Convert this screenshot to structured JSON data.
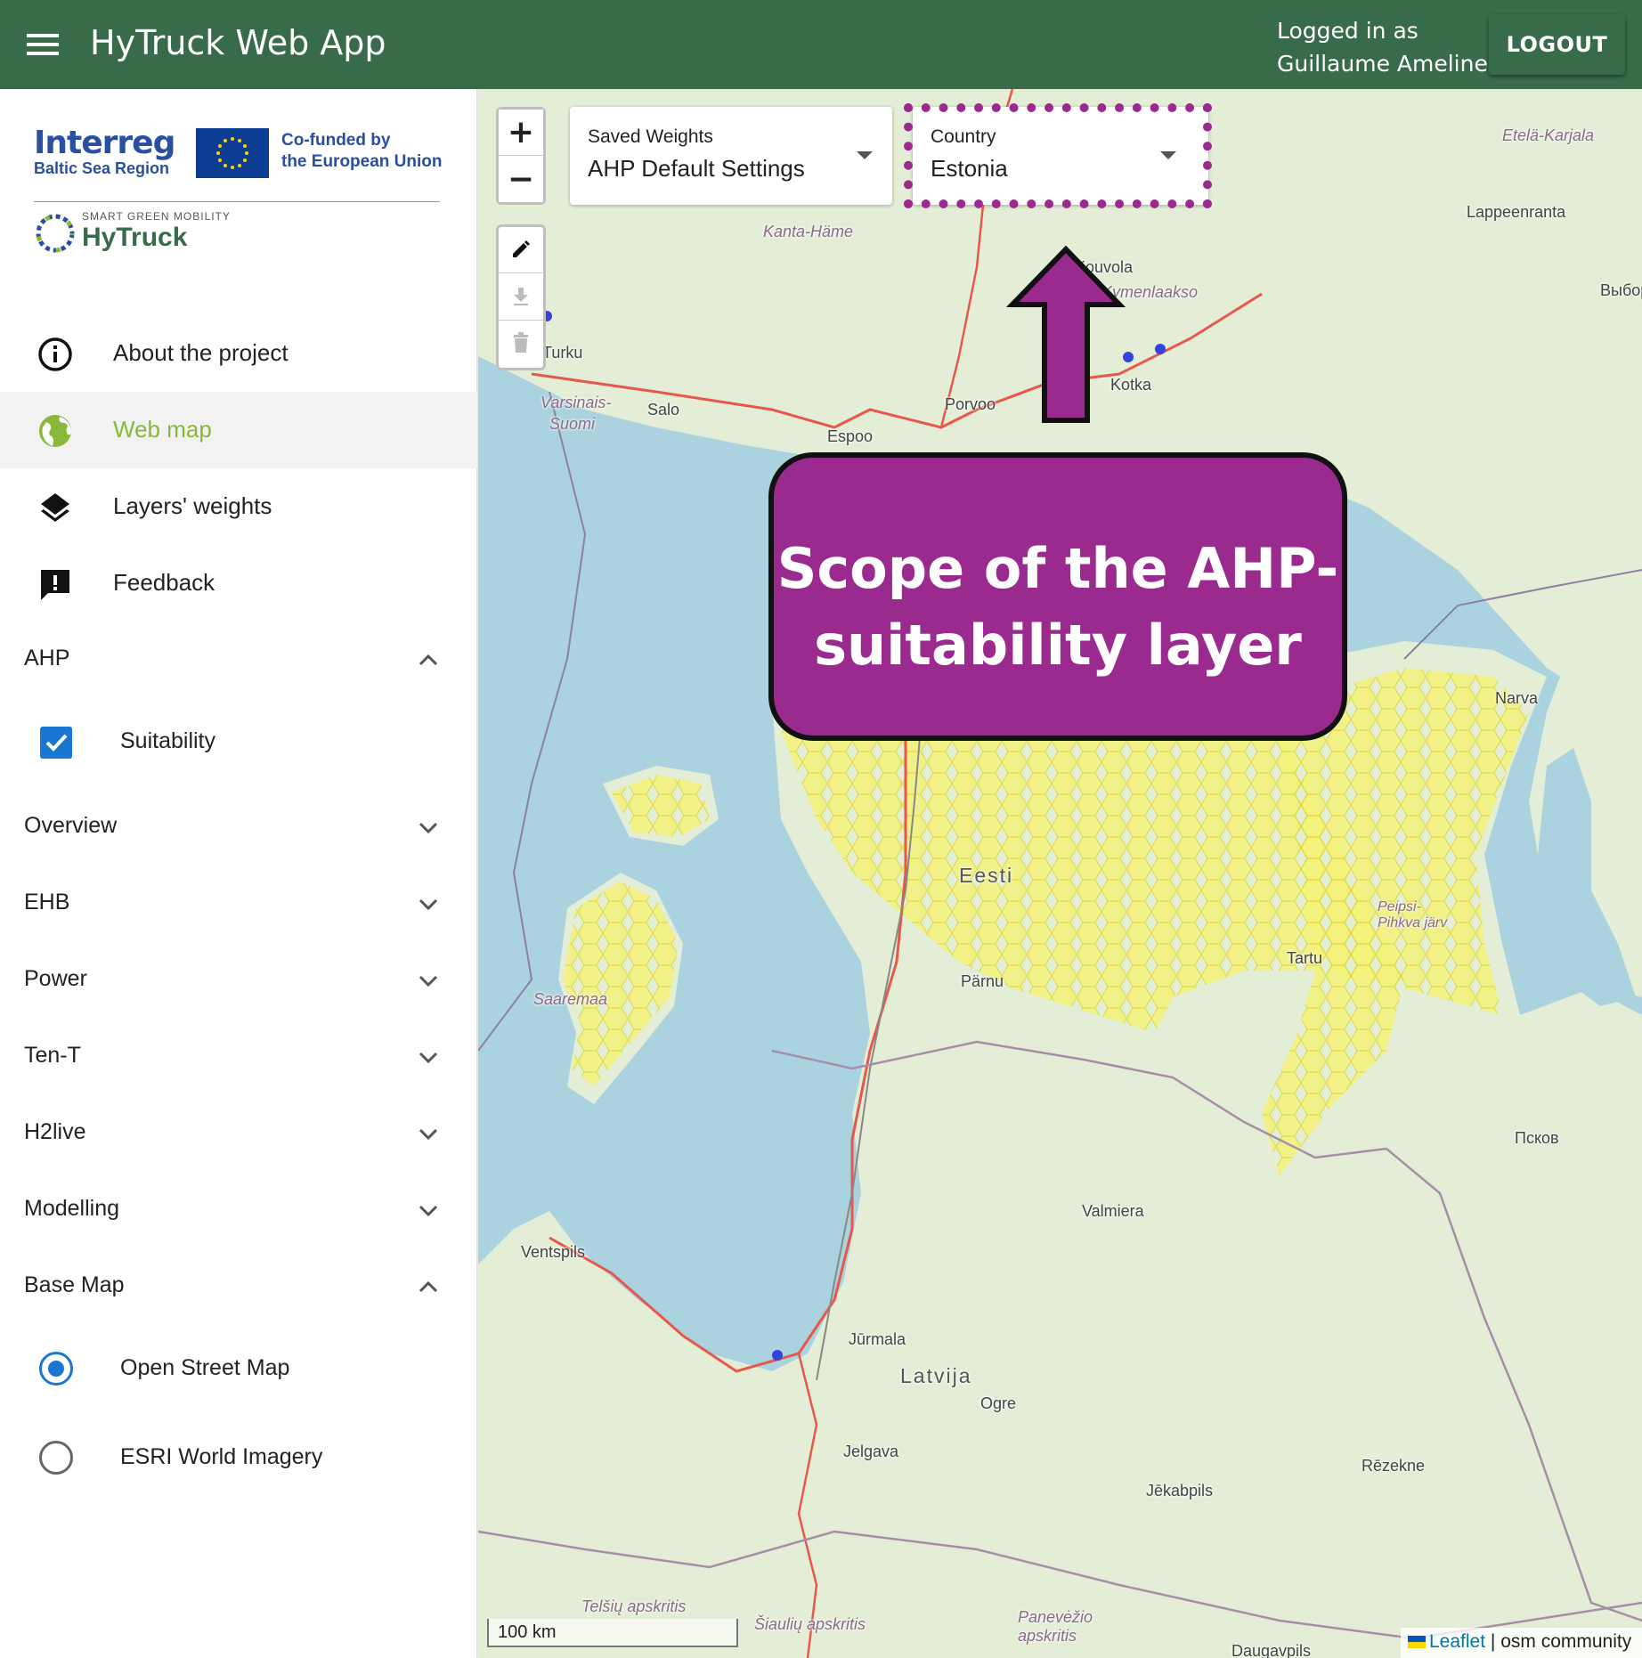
{
  "appbar": {
    "title": "HyTruck Web App",
    "login_line1": "Logged in as",
    "login_line2": "Guillaume Ameline",
    "logout_label": "LOGOUT"
  },
  "logos": {
    "interreg": "Interreg",
    "interreg_sub": "Baltic Sea Region",
    "cofunded_line1": "Co-funded by",
    "cofunded_line2": "the European Union",
    "hytruck_tag": "SMART GREEN MOBILITY",
    "hytruck_name": "HyTruck"
  },
  "nav": {
    "about": "About the project",
    "webmap": "Web map",
    "layers": "Layers' weights",
    "feedback": "Feedback"
  },
  "sections": {
    "ahp": "AHP",
    "suitability": "Suitability",
    "overview": "Overview",
    "ehb": "EHB",
    "power": "Power",
    "tent": "Ten-T",
    "h2live": "H2live",
    "modelling": "Modelling",
    "basemap": "Base Map",
    "osm": "Open Street Map",
    "esri": "ESRI World Imagery"
  },
  "map": {
    "zoom_in": "+",
    "zoom_out": "−",
    "saved_weights_label": "Saved Weights",
    "saved_weights_value": "AHP Default Settings",
    "country_label": "Country",
    "country_value": "Estonia",
    "callout": "Scope of the AHP-suitability layer",
    "scale": "100 km",
    "attrib_leaflet": "Leaflet",
    "attrib_rest": "| osm community",
    "labels": {
      "turku": "Turku",
      "varsinais": "Varsinais-",
      "suomi": "Suomi",
      "salo": "Salo",
      "espoo": "Espoo",
      "porvoo": "Porvoo",
      "kotka": "Kotka",
      "kouvola": "Kouvola",
      "kymenlaakso": "Kymenlaakso",
      "lappeenranta": "Lappeenranta",
      "etela_karjala": "Etelä-Karjala",
      "vyborg": "Выборг",
      "kanta_hame": "Kanta-Häme",
      "narva": "Narva",
      "eesti": "Eesti",
      "parnu": "Pärnu",
      "tartu": "Tartu",
      "saaremaa": "Saaremaa",
      "pihkva": "Peipsi-Pihkva järv",
      "pskov": "Псков",
      "valmiera": "Valmiera",
      "ventspils": "Ventspils",
      "jurmala": "Jūrmala",
      "latvija": "Latvija",
      "ogre": "Ogre",
      "jelgava": "Jelgava",
      "jekabpils": "Jēkabpils",
      "rezekne": "Rēzekne",
      "telsiu": "Telšių apskritis",
      "siauliu": "Šiaulių apskritis",
      "panevezio": "Panevėžio apskritis",
      "daugavpils": "Daugavpils"
    }
  },
  "colors": {
    "appbar": "#376b49",
    "accent_green": "#8ab83a",
    "callout": "#9b2a8f",
    "checkbox": "#1976d2",
    "water": "#aad3df",
    "land": "#e4eed6"
  }
}
